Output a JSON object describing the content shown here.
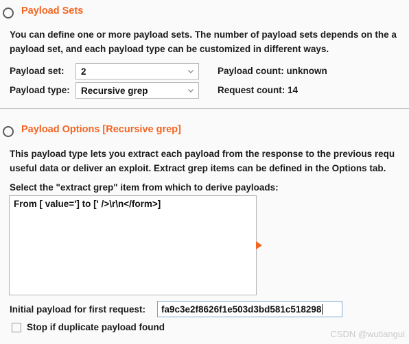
{
  "sections": [
    {
      "id": "payload-sets",
      "title": "Payload Sets",
      "description_line1": "You can define one or more payload sets. The number of payload sets depends on the a",
      "description_line2": "payload set, and each payload type can be customized in different ways.",
      "fields": {
        "payload_set_label": "Payload set:",
        "payload_set_value": "2",
        "payload_type_label": "Payload type:",
        "payload_type_value": "Recursive grep",
        "payload_count_label": "Payload count:",
        "payload_count_value": "unknown",
        "request_count_label": "Request count:",
        "request_count_value": "14"
      }
    },
    {
      "id": "payload-options",
      "title": "Payload Options [Recursive grep]",
      "description_line1": "This payload type lets you extract each payload from the response to the previous requ",
      "description_line2": "useful data or deliver an exploit. Extract grep items can be defined in the Options tab.",
      "select_label": "Select the \"extract grep\" item from which to derive payloads:",
      "list_items": [
        "From [ value='] to [' />\\r\\n</form>]"
      ],
      "initial_payload_label": "Initial payload for first request:",
      "initial_payload_value": "fa9c3e2f8626f1e503d3bd581c518298",
      "stop_duplicate_label": "Stop if duplicate payload found",
      "stop_duplicate_checked": false
    }
  ],
  "watermark": "CSDN @wutiangui",
  "colors": {
    "accent": "#f26522",
    "background": "#fafafa",
    "text": "#1a1a1a",
    "border": "#b5b5b5",
    "focus_border": "#7aa5d2"
  },
  "icons": {
    "collapse": "circle-collapse-icon",
    "dropdown": "chevron-down-icon",
    "marker": "orange-play-arrow-icon"
  }
}
